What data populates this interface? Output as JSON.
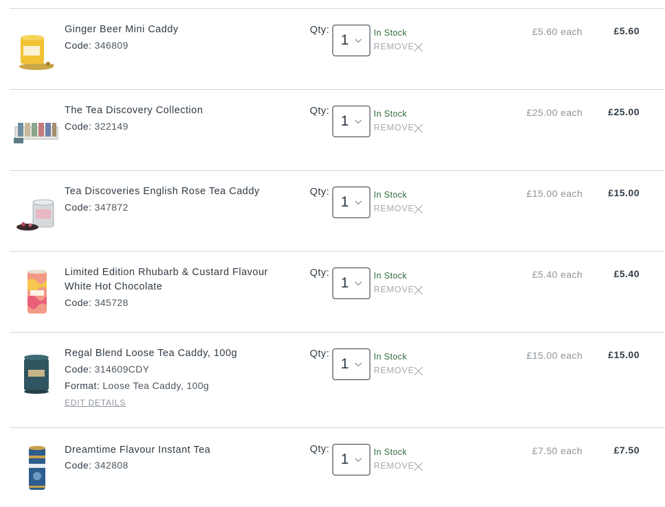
{
  "cart": {
    "qty_label": "Qty:",
    "items": [
      {
        "name": "Ginger Beer Mini Caddy",
        "code_label": "Code:",
        "code": "346809",
        "qty": "1",
        "stock": "In Stock",
        "remove": "REMOVE",
        "each": "£5.60 each",
        "total": "£5.60"
      },
      {
        "name": "The Tea Discovery Collection",
        "code_label": "Code:",
        "code": "322149",
        "qty": "1",
        "stock": "In Stock",
        "remove": "REMOVE",
        "each": "£25.00 each",
        "total": "£25.00"
      },
      {
        "name": "Tea Discoveries English Rose Tea Caddy",
        "code_label": "Code:",
        "code": "347872",
        "qty": "1",
        "stock": "In Stock",
        "remove": "REMOVE",
        "each": "£15.00 each",
        "total": "£15.00"
      },
      {
        "name": "Limited Edition Rhubarb & Custard Flavour White Hot Chocolate",
        "code_label": "Code:",
        "code": "345728",
        "qty": "1",
        "stock": "In Stock",
        "remove": "REMOVE",
        "each": "£5.40 each",
        "total": "£5.40"
      },
      {
        "name": "Regal Blend Loose Tea Caddy, 100g",
        "code_label": "Code:",
        "code": "314609CDY",
        "format_label": "Format:",
        "format": "Loose Tea Caddy, 100g",
        "edit": "EDIT DETAILS",
        "qty": "1",
        "stock": "In Stock",
        "remove": "REMOVE",
        "each": "£15.00 each",
        "total": "£15.00"
      },
      {
        "name": "Dreamtime Flavour Instant Tea",
        "code_label": "Code:",
        "code": "342808",
        "qty": "1",
        "stock": "In Stock",
        "remove": "REMOVE",
        "each": "£7.50 each",
        "total": "£7.50"
      }
    ]
  },
  "colors": {
    "text": "#2f3a44",
    "stock_green": "#2f6b3a",
    "muted": "#8c9399",
    "divider": "#d6d6d6"
  },
  "icons": {
    "qty_dropdown": "chevron-down-icon",
    "remove": "close-icon"
  }
}
